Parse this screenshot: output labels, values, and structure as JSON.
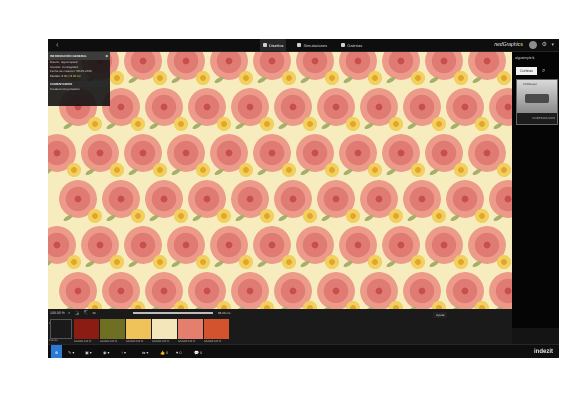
{
  "app": {
    "back_glyph": "‹",
    "tabs": [
      {
        "label": "Diseños",
        "icon": "grid-icon",
        "active": true
      },
      {
        "label": "Simulaciones",
        "icon": "images-icon",
        "active": false
      },
      {
        "label": "Galerías",
        "icon": "gallery-icon",
        "active": false
      }
    ],
    "brand_prefix": "nedGraphic",
    "brand_suffix": "s",
    "gear_glyph": "⚙",
    "menu_glyph": "▾"
  },
  "info_panel": {
    "header": "INFORMACIÓN GENERAL",
    "close_glyph": "⊗",
    "lines": [
      "Diseño: algosimple/k",
      "Usuario: Contagolled",
      "Fecha de creación: 08-05-2019",
      "Medida: 8.00 x 8.00 cm"
    ],
    "comments_header": "COMENTARIOS",
    "comment": "Created using ideation"
  },
  "right_panel": {
    "title": "algosimple/k",
    "search_label": "Cortinas",
    "search_glyph": "⌕",
    "card_label": "1000kaput",
    "card_caption": "CORTINAS ROS"
  },
  "palette": {
    "zoom": "100.00 %",
    "tool_glyphs": "⌕⇲⇱▭",
    "ruler_value": "96.00 cm",
    "swatch_index": "1",
    "fondo_label": "Fondo",
    "swatches": [
      {
        "color": "#8b1c14",
        "code": "AAAA01 100 %"
      },
      {
        "color": "#6f6f24",
        "code": "AAAA02 100 %"
      },
      {
        "color": "#f0c35a",
        "code": "AAAA03 100 %"
      },
      {
        "color": "#f2e6ba",
        "code": "AAAA04 100 %"
      },
      {
        "color": "#e47f6d",
        "code": "AAAA05 100 %"
      },
      {
        "color": "#d3532e",
        "code": "AAAA06 100 %"
      }
    ]
  },
  "bottom": {
    "items": [
      {
        "glyph": "⊕",
        "label": ""
      },
      {
        "glyph": "✎",
        "label": "▾"
      },
      {
        "glyph": "▣",
        "label": "▾"
      },
      {
        "glyph": "◉",
        "label": "▾"
      },
      {
        "glyph": "↑",
        "label": "▾"
      },
      {
        "glyph": "⇆",
        "label": "▾"
      },
      {
        "glyph": "👍",
        "label": "0"
      },
      {
        "glyph": "♥",
        "label": "0"
      },
      {
        "glyph": "💬",
        "label": "0"
      }
    ],
    "tooltip": "Ayuda",
    "logo": "indezit"
  }
}
